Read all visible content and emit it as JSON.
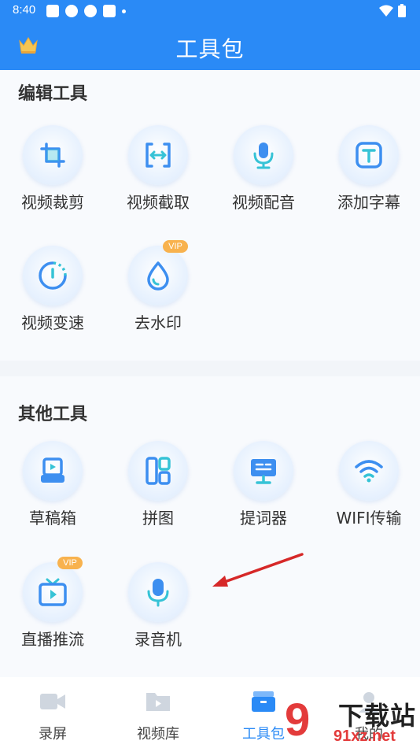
{
  "status_bar": {
    "time": "8:40"
  },
  "header": {
    "title": "工具包"
  },
  "sections": [
    {
      "title": "编辑工具",
      "tools": [
        {
          "label": "视频裁剪",
          "icon": "crop-icon",
          "vip": false
        },
        {
          "label": "视频截取",
          "icon": "clip-range-icon",
          "vip": false
        },
        {
          "label": "视频配音",
          "icon": "microphone-icon",
          "vip": false
        },
        {
          "label": "添加字幕",
          "icon": "subtitle-icon",
          "vip": false
        },
        {
          "label": "视频变速",
          "icon": "speed-gauge-icon",
          "vip": false
        },
        {
          "label": "去水印",
          "icon": "water-drop-icon",
          "vip": true,
          "vip_label": "VIP"
        }
      ]
    },
    {
      "title": "其他工具",
      "tools": [
        {
          "label": "草稿箱",
          "icon": "drafts-icon",
          "vip": false
        },
        {
          "label": "拼图",
          "icon": "collage-icon",
          "vip": false
        },
        {
          "label": "提词器",
          "icon": "teleprompter-icon",
          "vip": false
        },
        {
          "label": "WIFI传输",
          "icon": "wifi-icon",
          "vip": false
        },
        {
          "label": "直播推流",
          "icon": "live-tv-icon",
          "vip": true,
          "vip_label": "VIP"
        },
        {
          "label": "录音机",
          "icon": "recorder-mic-icon",
          "vip": false
        }
      ]
    }
  ],
  "bottom_nav": [
    {
      "label": "录屏",
      "icon": "video-camera-icon",
      "active": false
    },
    {
      "label": "视频库",
      "icon": "video-folder-icon",
      "active": false
    },
    {
      "label": "工具包",
      "icon": "toolbox-icon",
      "active": true
    },
    {
      "label": "我的",
      "icon": "profile-icon",
      "active": false
    }
  ],
  "watermark": {
    "logo": "9",
    "text": "下载站",
    "url": "91xz.net"
  },
  "colors": {
    "primary": "#2a8af6",
    "vip": "#f8b24e",
    "icon_blue": "#3d8ff0",
    "icon_cyan": "#36c3d6",
    "arrow": "#d62828"
  }
}
